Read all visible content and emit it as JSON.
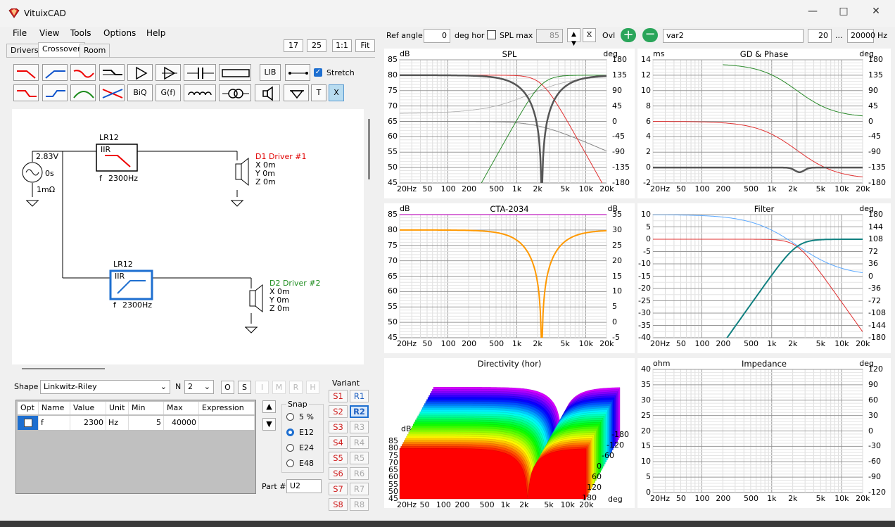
{
  "window": {
    "title": "VituixCAD"
  },
  "menu": [
    "File",
    "View",
    "Tools",
    "Options",
    "Help"
  ],
  "tabs": [
    "Drivers",
    "Crossover",
    "Room"
  ],
  "zoom_buttons": [
    "17",
    "25",
    "1:1",
    "Fit"
  ],
  "toolbar": {
    "lib_label": "LIB",
    "biq_label": "BiQ",
    "gf_label": "G(f)",
    "t_label": "T",
    "x_label": "X",
    "stretch_label": "Stretch"
  },
  "schematic": {
    "source": {
      "voltage": "2.83V",
      "delay": "0s",
      "impedance": "1mΩ"
    },
    "block1": {
      "name": "LR12",
      "type": "IIR",
      "f_label": "f",
      "f_value": "2300Hz"
    },
    "block2": {
      "name": "LR12",
      "type": "IIR",
      "f_label": "f",
      "f_value": "2300Hz"
    },
    "driver1": {
      "name": "D1 Driver #1",
      "x": "X 0m",
      "y": "Y 0m",
      "z": "Z 0m"
    },
    "driver2": {
      "name": "D2 Driver #2",
      "x": "X 0m",
      "y": "Y 0m",
      "z": "Z 0m"
    },
    "colors": {
      "driver1": "#e00000",
      "driver2": "#1a8a1a",
      "selected": "#1e6fd0"
    }
  },
  "shape": {
    "label": "Shape",
    "value": "Linkwitz-Riley",
    "n_label": "N",
    "n_value": "2",
    "buttons": [
      "O",
      "S",
      "I",
      "M",
      "R",
      "H"
    ]
  },
  "table": {
    "headers": [
      "Opt",
      "Name",
      "Value",
      "Unit",
      "Min",
      "Max",
      "Expression"
    ],
    "rows": [
      {
        "name": "f",
        "value": "2300",
        "unit": "Hz",
        "min": "5",
        "max": "40000",
        "expression": ""
      }
    ]
  },
  "snap": {
    "label": "Snap",
    "options": [
      "5 %",
      "E12",
      "E24",
      "E48"
    ],
    "selected": "E12"
  },
  "variant": {
    "label": "Variant",
    "s_buttons": [
      "S1",
      "S2",
      "S3",
      "S4",
      "S5",
      "S6",
      "S7",
      "S8"
    ],
    "r_buttons": [
      "R1",
      "R2",
      "R3",
      "R4",
      "R5",
      "R6",
      "R7",
      "R8"
    ],
    "active": "R2"
  },
  "part": {
    "label": "Part #",
    "value": "U2"
  },
  "topbar": {
    "ref_angle_label": "Ref angle",
    "ref_angle_value": "0",
    "deg_hor_label": "deg hor",
    "spl_max_label": "SPL max",
    "spl_max_value": "85",
    "ovl_label": "Ovl",
    "variant_name": "var2",
    "f_min": "20",
    "dots": "...",
    "f_max": "20000",
    "hz_label": "Hz"
  },
  "x_ticks": [
    "20Hz",
    "50",
    "100",
    "200",
    "500",
    "1k",
    "2k",
    "5k",
    "10k",
    "20k"
  ],
  "charts": {
    "spl": {
      "title": "SPL",
      "left_unit": "dB",
      "right_unit": "deg",
      "left_ticks": [
        "85",
        "80",
        "75",
        "70",
        "65",
        "60",
        "55",
        "50",
        "45"
      ],
      "right_ticks": [
        "180",
        "135",
        "90",
        "45",
        "0",
        "-45",
        "-90",
        "-135",
        "-180"
      ]
    },
    "gd": {
      "title": "GD & Phase",
      "left_unit": "ms",
      "right_unit": "deg",
      "left_ticks": [
        "14",
        "12",
        "10",
        "8",
        "6",
        "4",
        "2",
        "0",
        "-2"
      ],
      "right_ticks": [
        "180",
        "135",
        "90",
        "45",
        "0",
        "-45",
        "-90",
        "-135",
        "-180"
      ]
    },
    "cta": {
      "title": "CTA-2034",
      "left_unit": "dB",
      "right_unit": "dB",
      "left_ticks": [
        "85",
        "80",
        "75",
        "70",
        "65",
        "60",
        "55",
        "50",
        "45"
      ],
      "right_ticks": [
        "35",
        "30",
        "25",
        "20",
        "15",
        "10",
        "5",
        "0",
        "-5"
      ]
    },
    "filter": {
      "title": "Filter",
      "left_unit": "",
      "right_unit": "deg",
      "left_ticks": [
        "10",
        "5",
        "0",
        "-5",
        "-10",
        "-15",
        "-20",
        "-25",
        "-30",
        "-35",
        "-40"
      ],
      "right_ticks": [
        "180",
        "144",
        "108",
        "72",
        "36",
        "0",
        "-36",
        "-72",
        "-108",
        "-144",
        "-180"
      ]
    },
    "dir": {
      "title": "Directivity (hor)",
      "left_unit": "dB",
      "left_ticks": [
        "85",
        "80",
        "75",
        "70",
        "65",
        "60",
        "55",
        "50",
        "45"
      ],
      "x_ticks": [
        "20Hz",
        "50",
        "100",
        "200",
        "500",
        "1k",
        "2k",
        "5k",
        "10k",
        "20k"
      ],
      "angle_ticks": [
        "-180",
        "-120",
        "-60",
        "0",
        "60",
        "120",
        "180"
      ],
      "angle_unit": "deg"
    },
    "imp": {
      "title": "Impedance",
      "left_unit": "ohm",
      "right_unit": "deg",
      "left_ticks": [
        "40",
        "35",
        "30",
        "25",
        "20",
        "15",
        "10",
        "5",
        "0"
      ],
      "right_ticks": [
        "120",
        "90",
        "60",
        "30",
        "0",
        "-30",
        "-60",
        "-90",
        "-120"
      ]
    }
  },
  "chart_data": [
    {
      "type": "line",
      "title": "SPL",
      "x": [
        20,
        100,
        500,
        1000,
        2000,
        2300,
        3000,
        5000,
        10000,
        20000
      ],
      "series": [
        {
          "name": "D1 Driver #1",
          "color": "#e03030",
          "values": [
            80,
            80,
            79.5,
            78,
            74,
            73,
            70,
            63,
            52,
            42
          ]
        },
        {
          "name": "D2 Driver #2",
          "color": "#2a8a2a",
          "values": [
            40,
            40,
            45,
            59,
            72,
            73,
            76,
            78.5,
            79.5,
            80
          ]
        },
        {
          "name": "Sum",
          "color": "#555555",
          "values": [
            80,
            80,
            79.5,
            78,
            68,
            45,
            68,
            78,
            79.5,
            80
          ]
        }
      ]
    },
    {
      "type": "line",
      "title": "CTA-2034",
      "x": [
        20,
        100,
        500,
        1000,
        2000,
        2300,
        3000,
        5000,
        10000,
        20000
      ],
      "series": [
        {
          "name": "",
          "color": "#ff9900",
          "values": [
            80,
            80,
            79.5,
            78,
            68,
            45,
            68,
            78,
            79.5,
            80
          ]
        }
      ]
    },
    {
      "type": "line",
      "title": "Filter",
      "x": [
        20,
        100,
        500,
        1000,
        2000,
        2300,
        3000,
        5000,
        10000,
        20000
      ],
      "series": [
        {
          "name": "D1",
          "color": "#e03030",
          "values": [
            0,
            0,
            -0.2,
            -1,
            -5,
            -6,
            -9,
            -16,
            -28,
            -38
          ]
        },
        {
          "name": "D2",
          "color": "#108080",
          "values": [
            -60,
            -48,
            -22,
            -12,
            -6,
            -5,
            -3,
            -1,
            -0.2,
            0
          ]
        }
      ]
    }
  ]
}
